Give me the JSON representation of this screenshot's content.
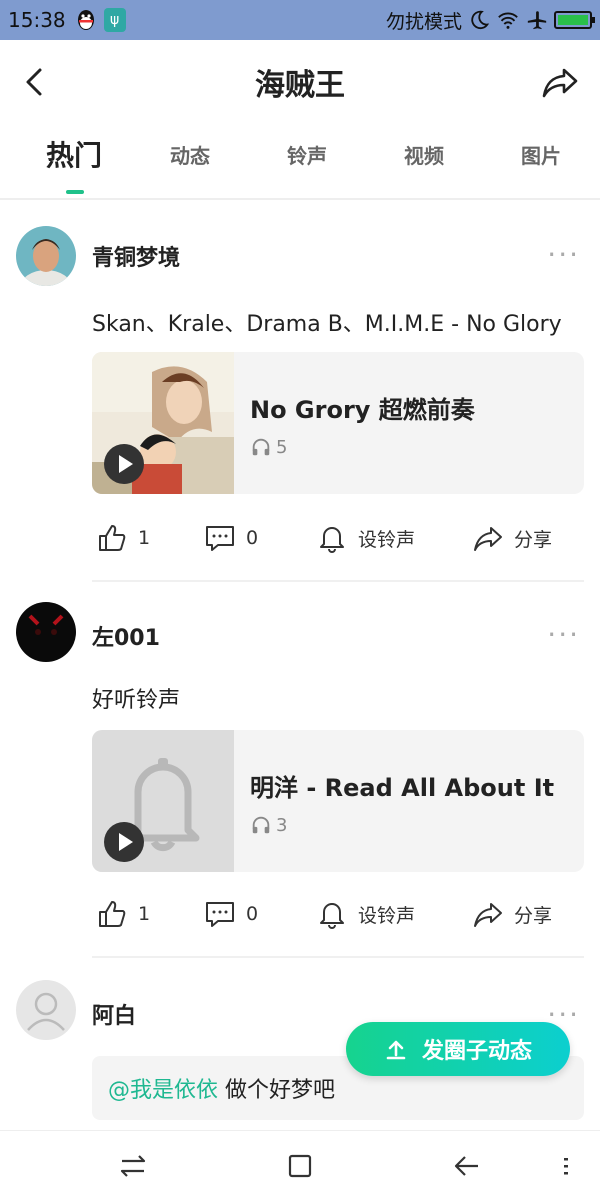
{
  "status": {
    "time": "15:38",
    "mode": "勿扰模式",
    "usb": "ψ"
  },
  "header": {
    "title": "海贼王"
  },
  "tabs": [
    {
      "label": "热门"
    },
    {
      "label": "动态"
    },
    {
      "label": "铃声"
    },
    {
      "label": "视频"
    },
    {
      "label": "图片"
    }
  ],
  "posts": [
    {
      "user": "青铜梦境",
      "text": "Skan、Krale、Drama B、M.I.M.E - No Glory",
      "card_title": "No Grory 超燃前奏",
      "plays": "5",
      "likes": "1",
      "comments": "0",
      "ringtone": "设铃声",
      "share": "分享"
    },
    {
      "user": "左001",
      "text": "好听铃声",
      "card_title": "明洋 - Read All About It",
      "plays": "3",
      "likes": "1",
      "comments": "0",
      "ringtone": "设铃声",
      "share": "分享"
    },
    {
      "user": "阿白",
      "mention": "@我是依依",
      "text": " 做个好梦吧"
    }
  ],
  "fab": {
    "label": "发圈子动态"
  },
  "more": "···",
  "colors": {
    "accent": "#1fc18a",
    "statusbar": "#7f9bcf"
  }
}
